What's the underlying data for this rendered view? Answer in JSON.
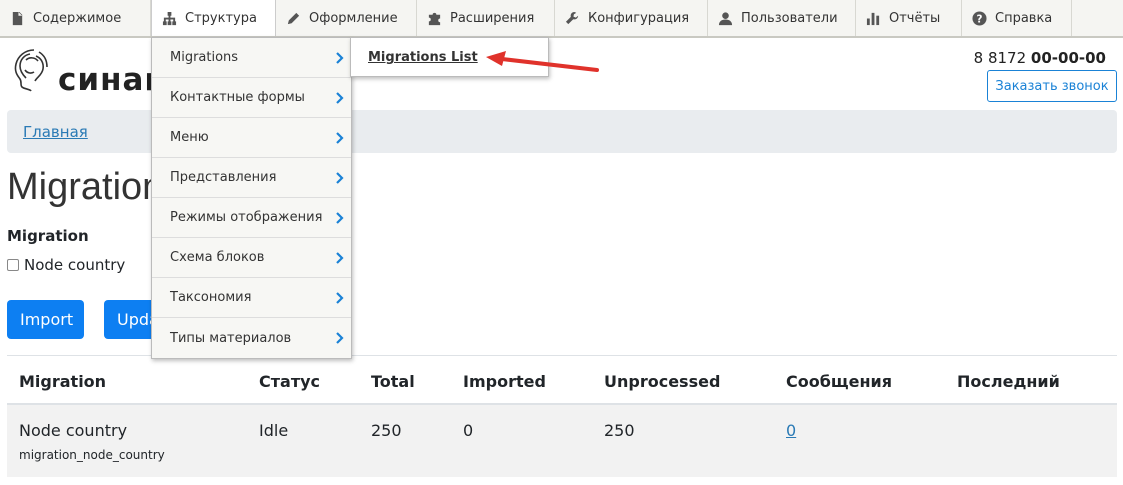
{
  "toolbar": {
    "items": [
      {
        "label": "Содержимое",
        "icon": "file-icon"
      },
      {
        "label": "Структура",
        "icon": "sitemap-icon"
      },
      {
        "label": "Оформление",
        "icon": "brush-icon"
      },
      {
        "label": "Расширения",
        "icon": "puzzle-icon"
      },
      {
        "label": "Конфигурация",
        "icon": "wrench-icon"
      },
      {
        "label": "Пользователи",
        "icon": "user-icon"
      },
      {
        "label": "Отчёты",
        "icon": "chart-icon"
      },
      {
        "label": "Справка",
        "icon": "help-icon"
      }
    ]
  },
  "header": {
    "logo_text": "синап",
    "phone_prefix": "8 8172 ",
    "phone_main": "00-00-00",
    "callback_label": "Заказать звонок"
  },
  "breadcrumb": {
    "home": "Главная"
  },
  "page": {
    "title": "Migration",
    "fieldset_legend": "Migration",
    "checkbox_label": "Node country",
    "import_label": "Import",
    "update_label": "Upda"
  },
  "table": {
    "headers": [
      "Migration",
      "Статус",
      "Total",
      "Imported",
      "Unprocessed",
      "Сообщения",
      "Последний"
    ],
    "rows": [
      {
        "name": "Node country",
        "machine_name": "migration_node_country",
        "status": "Idle",
        "total": "250",
        "imported": "0",
        "unprocessed": "250",
        "messages": "0",
        "last": ""
      }
    ]
  },
  "menu": {
    "items": [
      "Migrations",
      "Контактные формы",
      "Меню",
      "Представления",
      "Режимы отображения",
      "Схема блоков",
      "Таксономия",
      "Типы материалов"
    ],
    "submenu_item": "Migrations List"
  },
  "colors": {
    "accent": "#0d7ff2",
    "link": "#2a7ab5",
    "chevron": "#1a82d6",
    "arrow": "#e0322b"
  }
}
